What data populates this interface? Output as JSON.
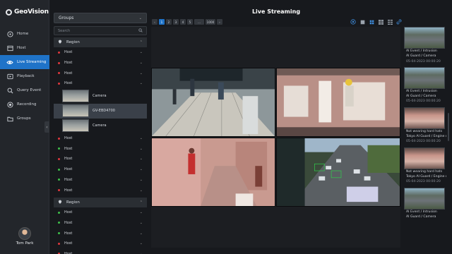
{
  "app": {
    "logo_text": "GeoVision",
    "page_title": "Live Streaming"
  },
  "nav": {
    "items": [
      {
        "label": "Home",
        "icon": "home-icon"
      },
      {
        "label": "Host",
        "icon": "host-icon"
      },
      {
        "label": "Live Streaming",
        "icon": "eye-icon",
        "active": true
      },
      {
        "label": "Playback",
        "icon": "playback-icon"
      },
      {
        "label": "Query Event",
        "icon": "search-icon"
      },
      {
        "label": "Recording",
        "icon": "record-icon"
      },
      {
        "label": "Groups",
        "icon": "folder-icon"
      }
    ],
    "user_name": "Tom Park"
  },
  "groups": {
    "dropdown_value": "Groups",
    "search_placeholder": "Search",
    "region1": "Region",
    "hosts_a": [
      "Host",
      "Host",
      "Host",
      "Host"
    ],
    "host_dots_a": [
      "#e0383d",
      "#e0383d",
      "#e0383d",
      "#e0383d"
    ],
    "cameras": [
      "Camera",
      "GV-EBD4700",
      "Camera"
    ],
    "hosts_b": [
      "Host",
      "Host",
      "Host",
      "Host",
      "Host",
      "Host"
    ],
    "host_dots_b": [
      "#e0383d",
      "#3fbf4a",
      "#e0383d",
      "#3fbf4a",
      "#3fbf4a",
      "#e0383d"
    ],
    "region2": "Region",
    "hosts_c": [
      "Host",
      "Host",
      "Host",
      "Host",
      "Host"
    ],
    "host_dots_c": [
      "#3fbf4a",
      "#3fbf4a",
      "#3fbf4a",
      "#e0383d",
      "#e0383d"
    ]
  },
  "pager": {
    "prev": "‹",
    "pages": [
      "1",
      "2",
      "3",
      "4",
      "5",
      "...",
      "1000"
    ],
    "next": "›",
    "current": "1"
  },
  "toolbar_icons": [
    "ai-icon",
    "layout-1x1-icon",
    "layout-2x2-icon",
    "layout-3x3-icon",
    "layout-4x4-icon",
    "link-icon"
  ],
  "events": [
    {
      "line1": "AI Event / Intrusion",
      "line2": "AI Guard / Camera",
      "time": "05-04-2023 00:00:20",
      "thumb": "street"
    },
    {
      "line1": "AI Event / Intrusion",
      "line2": "AI Guard / Camera",
      "time": "05-04-2023 00:00:20",
      "thumb": "street"
    },
    {
      "line1": "Not wearing hard hats",
      "line2": "Tokyo AI Guard / Engine room",
      "time": "05-04-2023 00:00:20",
      "thumb": "factory"
    },
    {
      "line1": "Not wearing hard hats",
      "line2": "Tokyo AI Guard / Engine room",
      "time": "05-04-2023 00:00:20",
      "thumb": "factory"
    },
    {
      "line1": "AI Event / Intrusion",
      "line2": "AI Guard / Camera",
      "time": "",
      "thumb": "street"
    }
  ],
  "colors": {
    "accent": "#1f73c8",
    "status_online": "#3fbf4a",
    "status_offline": "#e0383d"
  }
}
